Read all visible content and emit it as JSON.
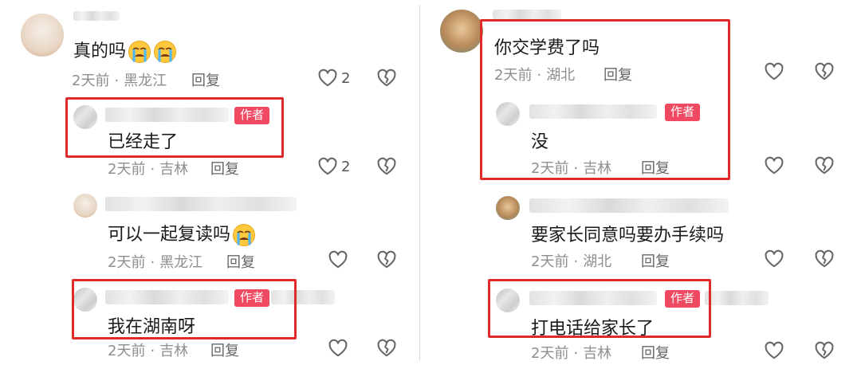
{
  "left": {
    "c1": {
      "text": "真的吗",
      "date": "2天前",
      "region": "黑龙江",
      "reply": "回复",
      "likes": "2"
    },
    "c2": {
      "badge": "作者",
      "text": "已经走了",
      "date": "2天前",
      "region": "吉林",
      "reply": "回复",
      "likes": "2"
    },
    "c3": {
      "text": "可以一起复读吗",
      "date": "2天前",
      "region": "黑龙江",
      "reply": "回复"
    },
    "c4": {
      "badge": "作者",
      "text": "我在湖南呀",
      "date": "2天前",
      "region": "吉林",
      "reply": "回复"
    }
  },
  "right": {
    "c1": {
      "text": "你交学费了吗",
      "date": "2天前",
      "region": "湖北",
      "reply": "回复"
    },
    "c2": {
      "badge": "作者",
      "text": "没",
      "date": "2天前",
      "region": "吉林",
      "reply": "回复"
    },
    "c3": {
      "text": "要家长同意吗要办手续吗",
      "date": "2天前",
      "region": "湖北",
      "reply": "回复"
    },
    "c4": {
      "badge": "作者",
      "text": "打电话给家长了",
      "date": "2天前",
      "region": "吉林",
      "reply": "回复"
    }
  },
  "icons": {
    "heart": "heart-outline-icon",
    "broken_heart": "broken-heart-icon",
    "emoji": "crying-face-emoji-icon"
  },
  "colors": {
    "author_badge": "#f04a63",
    "highlight_box": "#e02a2a",
    "meta_text": "#8e8e8e"
  }
}
